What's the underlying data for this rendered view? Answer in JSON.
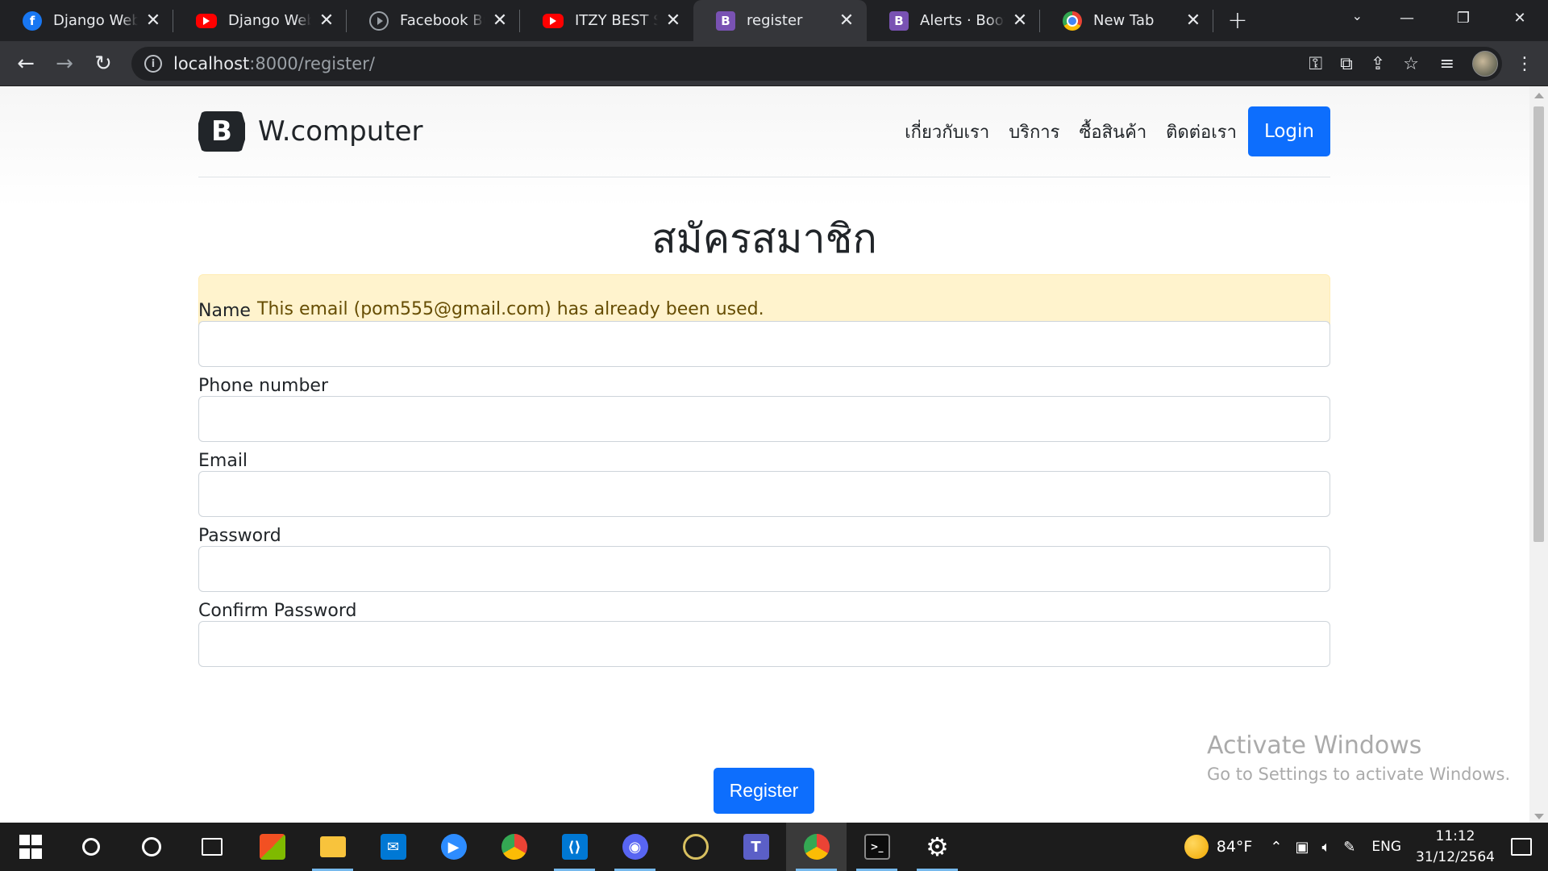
{
  "browser": {
    "tabs": [
      {
        "title": "Django Web De",
        "favicon": "facebook-icon"
      },
      {
        "title": "Django Web De",
        "favicon": "youtube-icon"
      },
      {
        "title": "Facebook Busin",
        "favicon": "meta-icon"
      },
      {
        "title": "ITZY BEST SON",
        "favicon": "youtube-icon"
      },
      {
        "title": "register",
        "favicon": "bootstrap-icon",
        "active": true
      },
      {
        "title": "Alerts · Bootstr",
        "favicon": "bootstrap-icon"
      },
      {
        "title": "New Tab",
        "favicon": "chrome-icon"
      }
    ],
    "close_glyph": "✕",
    "new_tab_glyph": "+",
    "url": {
      "host": "localhost",
      "path": ":8000/register/"
    }
  },
  "site": {
    "brand_letter": "B",
    "brand_name": "W.computer",
    "nav": [
      "เกี่ยวกับเรา",
      "บริการ",
      "ซื้อสินค้า",
      "ติดต่อเรา"
    ],
    "login_label": "Login"
  },
  "page": {
    "title": "สมัครสมาชิก",
    "alert": "This email (pom555@gmail.com) has already been used.",
    "fields": [
      {
        "label": "Name",
        "value": ""
      },
      {
        "label": "Phone number",
        "value": ""
      },
      {
        "label": "Email",
        "value": ""
      },
      {
        "label": "Password",
        "value": ""
      },
      {
        "label": "Confirm Password",
        "value": ""
      }
    ],
    "submit_label": "Register"
  },
  "watermark": {
    "line1": "Activate Windows",
    "line2": "Go to Settings to activate Windows."
  },
  "taskbar": {
    "weather": "84°F",
    "language": "ENG",
    "time": "11:12",
    "date": "31/12/2564"
  },
  "colors": {
    "primary": "#0d6efd",
    "alert_bg": "#fff3cd",
    "alert_text": "#664d03",
    "chrome_dark": "#202124"
  }
}
